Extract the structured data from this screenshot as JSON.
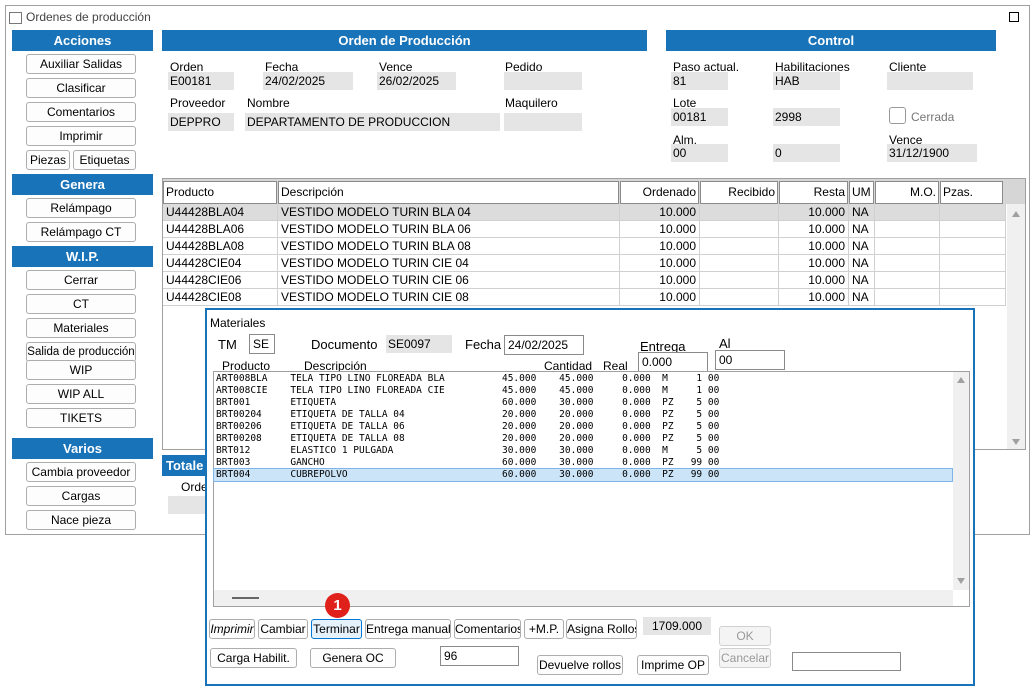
{
  "window": {
    "title": "Ordenes de producción"
  },
  "sidebar": {
    "acciones": {
      "header": "Acciones",
      "buttons": [
        "Auxiliar Salidas",
        "Clasificar",
        "Comentarios",
        "Imprimir"
      ],
      "piezas": "Piezas",
      "etiquetas": "Etiquetas"
    },
    "genera": {
      "header": "Genera",
      "buttons": [
        "Relámpago",
        "Relámpago CT"
      ]
    },
    "wip": {
      "header": "W.I.P.",
      "buttons": [
        "Cerrar",
        "CT",
        "Materiales",
        "Salida de producción",
        "WIP",
        "WIP ALL",
        "TIKETS"
      ]
    },
    "varios": {
      "header": "Varios",
      "buttons": [
        "Cambia proveedor",
        "Cargas",
        "Nace pieza"
      ]
    }
  },
  "orden_section": {
    "header": "Orden de Producción",
    "orden": {
      "label": "Orden",
      "value": "E00181"
    },
    "fecha": {
      "label": "Fecha",
      "value": "24/02/2025"
    },
    "vence": {
      "label": "Vence",
      "value": "26/02/2025"
    },
    "pedido": {
      "label": "Pedido",
      "value": ""
    },
    "proveedor": {
      "label": "Proveedor",
      "value": "DEPPRO"
    },
    "nombre": {
      "label": "Nombre",
      "value": "DEPARTAMENTO  DE PRODUCCION"
    },
    "maquilero": {
      "label": "Maquilero",
      "value": ""
    }
  },
  "control_section": {
    "header": "Control",
    "paso": {
      "label": "Paso actual.",
      "value": "81"
    },
    "habilitaciones": {
      "label": "Habilitaciones",
      "value": "HAB"
    },
    "cliente": {
      "label": "Cliente",
      "value": ""
    },
    "lote": {
      "label": "Lote",
      "value": "00181",
      "value2": "2998"
    },
    "cerrada": {
      "label": "Cerrada",
      "checked": false
    },
    "alm": {
      "label": "Alm.",
      "value": "00",
      "value2": "0"
    },
    "vence": {
      "label": "Vence",
      "value": "31/12/1900"
    }
  },
  "products_grid": {
    "columns": [
      "Producto",
      "Descripción",
      "Ordenado",
      "Recibido",
      "Resta",
      "UM",
      "M.O.",
      "Pzas."
    ],
    "rows": [
      [
        "U44428BLA04",
        "VESTIDO MODELO TURIN BLA 04",
        "10.000",
        "",
        "10.000",
        "NA",
        "",
        ""
      ],
      [
        "U44428BLA06",
        "VESTIDO MODELO TURIN BLA 06",
        "10.000",
        "",
        "10.000",
        "NA",
        "",
        ""
      ],
      [
        "U44428BLA08",
        "VESTIDO MODELO TURIN BLA 08",
        "10.000",
        "",
        "10.000",
        "NA",
        "",
        ""
      ],
      [
        "U44428CIE04",
        "VESTIDO MODELO TURIN CIE 04",
        "10.000",
        "",
        "10.000",
        "NA",
        "",
        ""
      ],
      [
        "U44428CIE06",
        "VESTIDO MODELO TURIN CIE 06",
        "10.000",
        "",
        "10.000",
        "NA",
        "",
        ""
      ],
      [
        "U44428CIE08",
        "VESTIDO MODELO TURIN CIE 08",
        "10.000",
        "",
        "10.000",
        "NA",
        "",
        ""
      ]
    ]
  },
  "totales": {
    "header": "Totale",
    "orden_label": "Orde"
  },
  "materiales": {
    "title": "Materiales",
    "tm": {
      "label": "TM",
      "value": "SE"
    },
    "documento": {
      "label": "Documento",
      "value": "SE0097"
    },
    "fecha": {
      "label": "Fecha",
      "value": "24/02/2025"
    },
    "entrega": {
      "label": "Entrega",
      "value": "0.000"
    },
    "al": {
      "label": "Al",
      "value": "00"
    },
    "columns": {
      "producto": "Producto",
      "descripcion": "Descripción",
      "cantidad": "Cantidad",
      "real": "Real"
    },
    "rows": [
      "ART008BLA    TELA TIPO LINO FLOREADA BLA          45.000    45.000     0.000  M     1 00",
      "ART008CIE    TELA TIPO LINO FLOREADA CIE          45.000    45.000     0.000  M     1 00",
      "BRT001       ETIQUETA                             60.000    30.000     0.000  PZ    5 00",
      "BRT00204     ETIQUETA DE TALLA 04                 20.000    20.000     0.000  PZ    5 00",
      "BRT00206     ETIQUETA DE TALLA 06                 20.000    20.000     0.000  PZ    5 00",
      "BRT00208     ETIQUETA DE TALLA 08                 20.000    20.000     0.000  PZ    5 00",
      "BRT012       ELASTICO 1 PULGADA                   30.000    30.000     0.000  M     5 00",
      "BRT003       GANCHO                               60.000    30.000     0.000  PZ   99 00",
      "BRT004       CUBREPOLVO                           60.000    30.000     0.000  PZ   99 00"
    ],
    "selected_row": 8,
    "buttons": {
      "imprimir": "Imprimir",
      "cambiar": "Cambiar",
      "terminar": "Terminar",
      "entrega_manual": "Entrega manual",
      "comentarios": "Comentarios",
      "mp": "+M.P.",
      "asigna_rollos": "Asigna Rollos",
      "total": "1709.000",
      "ok": "OK",
      "carga_habilit": "Carga Habilit.",
      "genera_oc": "Genera OC",
      "field96": "96",
      "devuelve_rollos": "Devuelve rollos",
      "imprime_op": "Imprime OP",
      "cancelar": "Cancelar"
    },
    "step_badge": "1"
  },
  "colors": {
    "accent": "#1873b8",
    "badge": "#e0201b",
    "selection": "#cce4f7"
  }
}
